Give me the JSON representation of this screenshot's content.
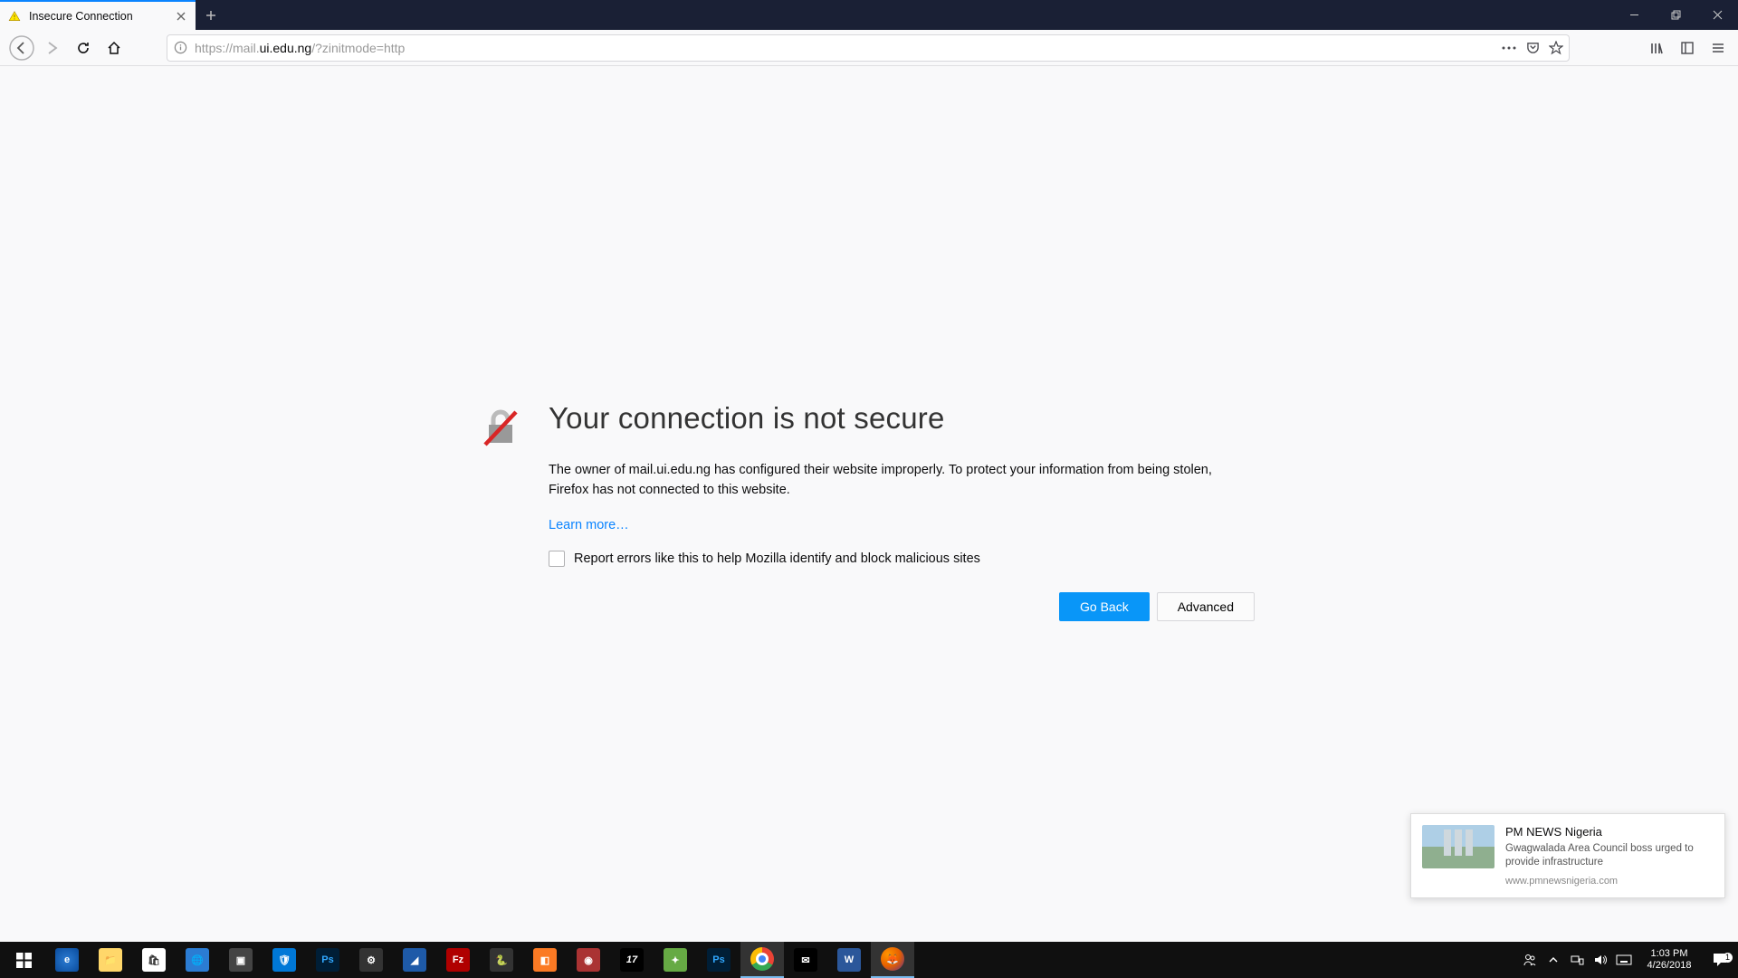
{
  "tab": {
    "title": "Insecure Connection"
  },
  "url": {
    "proto": "https://mail.",
    "domain": "ui.edu.ng",
    "path": "/?zinitmode=http"
  },
  "error": {
    "title": "Your connection is not secure",
    "desc": "The owner of mail.ui.edu.ng has configured their website improperly. To protect your information from being stolen, Firefox has not connected to this website.",
    "learn_more": "Learn more…",
    "report_label": "Report errors like this to help Mozilla identify and block malicious sites",
    "go_back": "Go Back",
    "advanced": "Advanced"
  },
  "toast": {
    "title": "PM NEWS Nigeria",
    "desc": "Gwagwalada Area Council boss urged to provide infrastructure",
    "source": "www.pmnewsnigeria.com"
  },
  "tray": {
    "time": "1:03 PM",
    "date": "4/26/2018",
    "notif_count": "1"
  }
}
